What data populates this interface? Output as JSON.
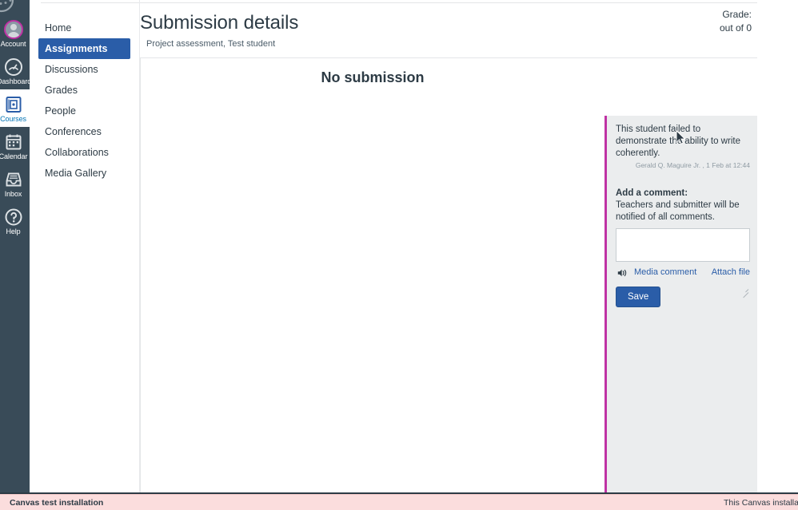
{
  "global_nav": {
    "logo_name": "canvas-logo",
    "items": [
      {
        "label": "Account",
        "icon": "user-avatar-icon",
        "active": false
      },
      {
        "label": "Dashboard",
        "icon": "dashboard-icon",
        "active": false
      },
      {
        "label": "Courses",
        "icon": "courses-book-icon",
        "active": true
      },
      {
        "label": "Calendar",
        "icon": "calendar-icon",
        "active": false
      },
      {
        "label": "Inbox",
        "icon": "inbox-tray-icon",
        "active": false
      },
      {
        "label": "Help",
        "icon": "help-question-icon",
        "active": false
      }
    ],
    "avatar_ring_color": "#BF32A4",
    "background_color": "#394B58",
    "active_text_color": "#0374B5"
  },
  "course_nav": {
    "items": [
      {
        "label": "Home",
        "active": false
      },
      {
        "label": "Assignments",
        "active": true
      },
      {
        "label": "Discussions",
        "active": false
      },
      {
        "label": "Grades",
        "active": false
      },
      {
        "label": "People",
        "active": false
      },
      {
        "label": "Conferences",
        "active": false
      },
      {
        "label": "Collaborations",
        "active": false
      },
      {
        "label": "Media Gallery",
        "active": false
      }
    ],
    "active_background_color": "#2A5DA8"
  },
  "header": {
    "title": "Submission details",
    "subtitle": "Project assessment, Test student",
    "grade_label": "Grade:",
    "points_possible": "out of 0"
  },
  "submission": {
    "status_text": "No submission"
  },
  "comments": {
    "divider_color": "#BF32A4",
    "existing": [
      {
        "body": "This student failed to demonstrate the ability to write coherently.",
        "author_and_time": "Gerald Q. Maguire Jr. , 1 Feb at 12:44"
      }
    ],
    "add_label": "Add a comment:",
    "notify_text": "Teachers and submitter will be notified of all comments.",
    "textarea_value": "",
    "textarea_placeholder": "",
    "media_comment_label": "Media comment",
    "media_comment_icon": "speaker-icon",
    "attach_file_label": "Attach file",
    "save_label": "Save",
    "save_color": "#2A5DA8"
  },
  "footer": {
    "left_text": "Canvas test installation",
    "right_text": "This Canvas installatio",
    "background_color": "#FBDDDD"
  }
}
